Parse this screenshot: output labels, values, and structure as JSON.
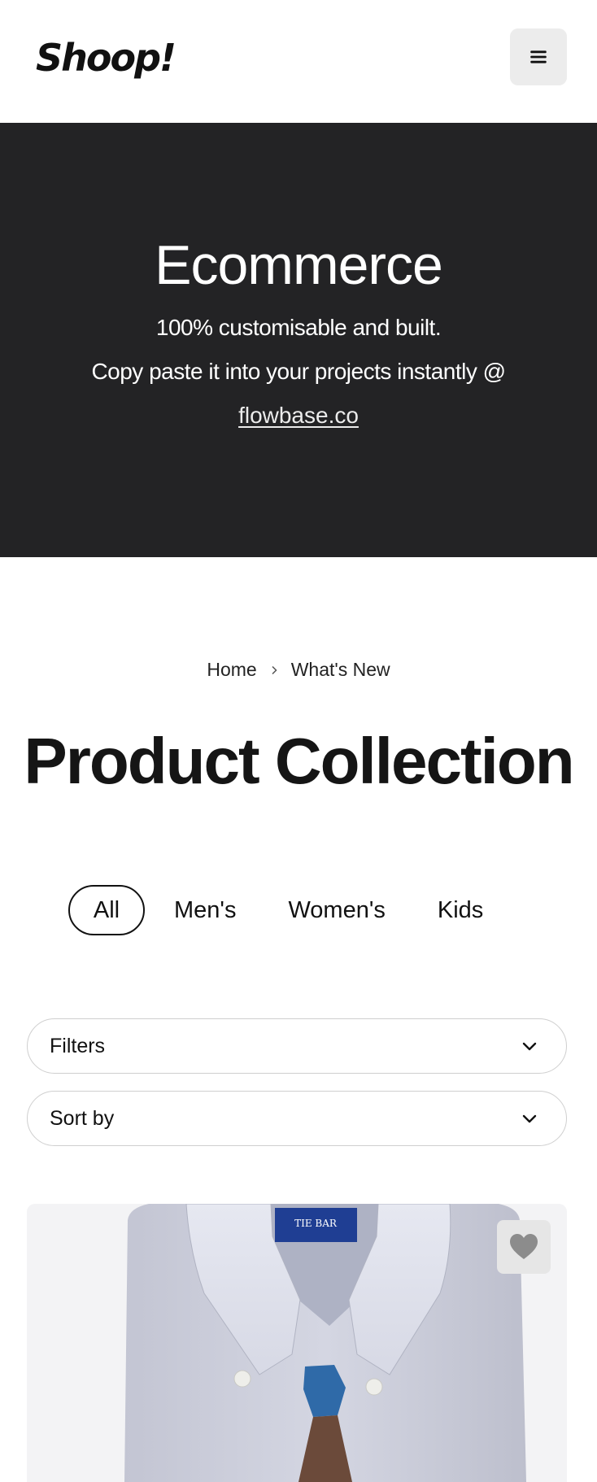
{
  "navbar": {
    "logo": "Shoop!",
    "menu_icon": "hamburger-menu-icon"
  },
  "hero": {
    "title": "Ecommerce",
    "line1": "100% customisable and built.",
    "line2": "Copy paste it into your projects instantly @",
    "link": "flowbase.co",
    "background_color": "#232325"
  },
  "breadcrumb": {
    "home": "Home",
    "current": "What's New"
  },
  "page": {
    "title": "Product Collection"
  },
  "tabs": [
    {
      "label": "All",
      "active": true
    },
    {
      "label": "Men's",
      "active": false
    },
    {
      "label": "Women's",
      "active": false
    },
    {
      "label": "Kids",
      "active": false
    }
  ],
  "filters": {
    "filters_label": "Filters",
    "sort_label": "Sort by"
  },
  "product": {
    "brand_tag": "TIE BAR",
    "wishlist_icon": "heart-icon"
  }
}
